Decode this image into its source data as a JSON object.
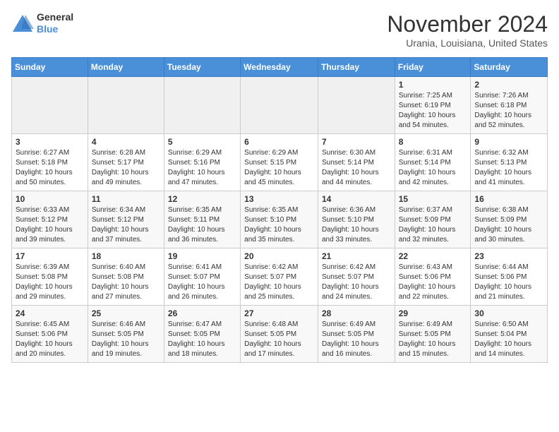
{
  "header": {
    "logo_line1": "General",
    "logo_line2": "Blue",
    "month": "November 2024",
    "location": "Urania, Louisiana, United States"
  },
  "weekdays": [
    "Sunday",
    "Monday",
    "Tuesday",
    "Wednesday",
    "Thursday",
    "Friday",
    "Saturday"
  ],
  "weeks": [
    [
      {
        "day": "",
        "empty": true
      },
      {
        "day": "",
        "empty": true
      },
      {
        "day": "",
        "empty": true
      },
      {
        "day": "",
        "empty": true
      },
      {
        "day": "",
        "empty": true
      },
      {
        "day": "1",
        "sunrise": "7:25 AM",
        "sunset": "6:19 PM",
        "daylight": "10 hours and 54 minutes."
      },
      {
        "day": "2",
        "sunrise": "7:26 AM",
        "sunset": "6:18 PM",
        "daylight": "10 hours and 52 minutes."
      }
    ],
    [
      {
        "day": "3",
        "sunrise": "6:27 AM",
        "sunset": "5:18 PM",
        "daylight": "10 hours and 50 minutes."
      },
      {
        "day": "4",
        "sunrise": "6:28 AM",
        "sunset": "5:17 PM",
        "daylight": "10 hours and 49 minutes."
      },
      {
        "day": "5",
        "sunrise": "6:29 AM",
        "sunset": "5:16 PM",
        "daylight": "10 hours and 47 minutes."
      },
      {
        "day": "6",
        "sunrise": "6:29 AM",
        "sunset": "5:15 PM",
        "daylight": "10 hours and 45 minutes."
      },
      {
        "day": "7",
        "sunrise": "6:30 AM",
        "sunset": "5:14 PM",
        "daylight": "10 hours and 44 minutes."
      },
      {
        "day": "8",
        "sunrise": "6:31 AM",
        "sunset": "5:14 PM",
        "daylight": "10 hours and 42 minutes."
      },
      {
        "day": "9",
        "sunrise": "6:32 AM",
        "sunset": "5:13 PM",
        "daylight": "10 hours and 41 minutes."
      }
    ],
    [
      {
        "day": "10",
        "sunrise": "6:33 AM",
        "sunset": "5:12 PM",
        "daylight": "10 hours and 39 minutes."
      },
      {
        "day": "11",
        "sunrise": "6:34 AM",
        "sunset": "5:12 PM",
        "daylight": "10 hours and 37 minutes."
      },
      {
        "day": "12",
        "sunrise": "6:35 AM",
        "sunset": "5:11 PM",
        "daylight": "10 hours and 36 minutes."
      },
      {
        "day": "13",
        "sunrise": "6:35 AM",
        "sunset": "5:10 PM",
        "daylight": "10 hours and 35 minutes."
      },
      {
        "day": "14",
        "sunrise": "6:36 AM",
        "sunset": "5:10 PM",
        "daylight": "10 hours and 33 minutes."
      },
      {
        "day": "15",
        "sunrise": "6:37 AM",
        "sunset": "5:09 PM",
        "daylight": "10 hours and 32 minutes."
      },
      {
        "day": "16",
        "sunrise": "6:38 AM",
        "sunset": "5:09 PM",
        "daylight": "10 hours and 30 minutes."
      }
    ],
    [
      {
        "day": "17",
        "sunrise": "6:39 AM",
        "sunset": "5:08 PM",
        "daylight": "10 hours and 29 minutes."
      },
      {
        "day": "18",
        "sunrise": "6:40 AM",
        "sunset": "5:08 PM",
        "daylight": "10 hours and 27 minutes."
      },
      {
        "day": "19",
        "sunrise": "6:41 AM",
        "sunset": "5:07 PM",
        "daylight": "10 hours and 26 minutes."
      },
      {
        "day": "20",
        "sunrise": "6:42 AM",
        "sunset": "5:07 PM",
        "daylight": "10 hours and 25 minutes."
      },
      {
        "day": "21",
        "sunrise": "6:42 AM",
        "sunset": "5:07 PM",
        "daylight": "10 hours and 24 minutes."
      },
      {
        "day": "22",
        "sunrise": "6:43 AM",
        "sunset": "5:06 PM",
        "daylight": "10 hours and 22 minutes."
      },
      {
        "day": "23",
        "sunrise": "6:44 AM",
        "sunset": "5:06 PM",
        "daylight": "10 hours and 21 minutes."
      }
    ],
    [
      {
        "day": "24",
        "sunrise": "6:45 AM",
        "sunset": "5:06 PM",
        "daylight": "10 hours and 20 minutes."
      },
      {
        "day": "25",
        "sunrise": "6:46 AM",
        "sunset": "5:05 PM",
        "daylight": "10 hours and 19 minutes."
      },
      {
        "day": "26",
        "sunrise": "6:47 AM",
        "sunset": "5:05 PM",
        "daylight": "10 hours and 18 minutes."
      },
      {
        "day": "27",
        "sunrise": "6:48 AM",
        "sunset": "5:05 PM",
        "daylight": "10 hours and 17 minutes."
      },
      {
        "day": "28",
        "sunrise": "6:49 AM",
        "sunset": "5:05 PM",
        "daylight": "10 hours and 16 minutes."
      },
      {
        "day": "29",
        "sunrise": "6:49 AM",
        "sunset": "5:05 PM",
        "daylight": "10 hours and 15 minutes."
      },
      {
        "day": "30",
        "sunrise": "6:50 AM",
        "sunset": "5:04 PM",
        "daylight": "10 hours and 14 minutes."
      }
    ]
  ]
}
